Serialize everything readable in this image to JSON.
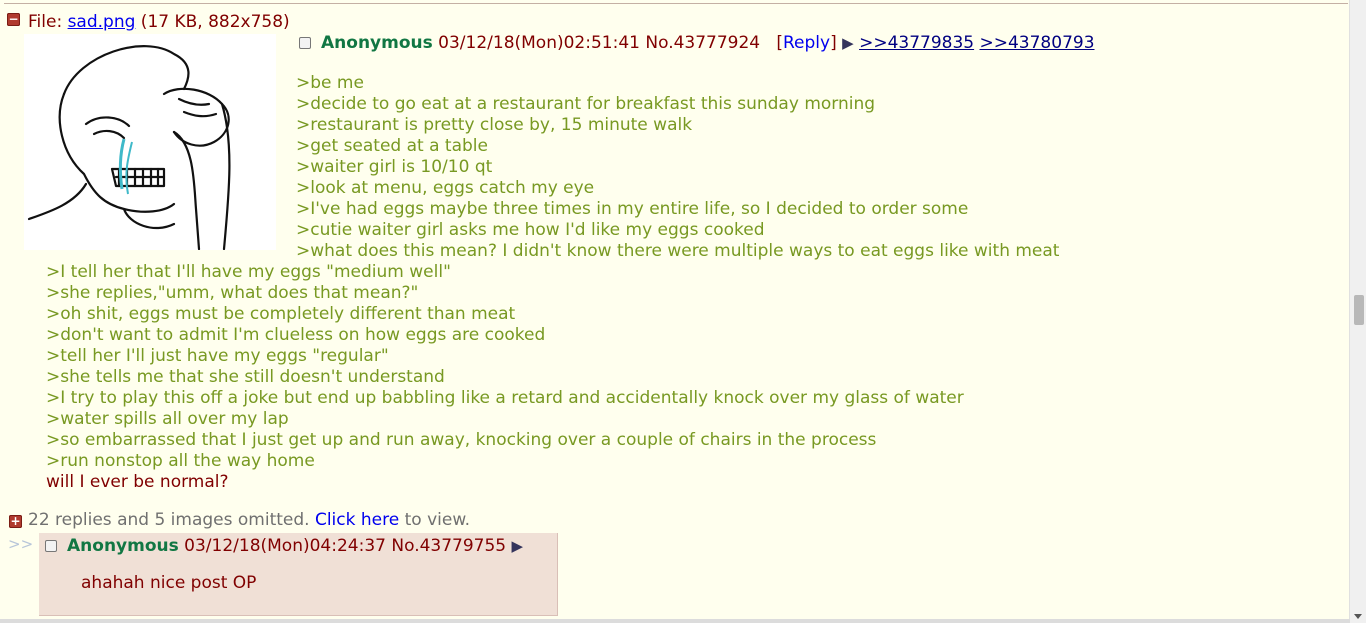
{
  "op": {
    "toggle_symbol": "−",
    "file_prefix": "File: ",
    "file_name": "sad.png",
    "file_meta": " (17 KB, 882x758)",
    "name": "Anonymous",
    "datetime": "03/12/18(Mon)02:51:41",
    "post_no": "No.43777924",
    "reply_label": "Reply",
    "backlinks": [
      ">>43779835",
      ">>43780793"
    ],
    "lines_beside_image": [
      ">be me",
      ">decide to go eat at a restaurant for breakfast this sunday morning",
      ">restaurant is pretty close by, 15 minute walk",
      ">get seated at a table",
      ">waiter girl is 10/10 qt",
      ">look at menu, eggs catch my eye",
      ">I've had eggs maybe three times in my entire life, so I decided to order some",
      ">cutie waiter girl asks me how I'd like my eggs cooked",
      ">what does this mean? I didn't know there were multiple ways to eat eggs like with meat"
    ],
    "lines_below_image": [
      ">I tell her that I'll have my eggs \"medium well\"",
      ">she replies,\"umm, what does that mean?\"",
      ">oh shit, eggs must be completely different than meat",
      ">don't want to admit I'm clueless on how eggs are cooked",
      ">tell her I'll just have my eggs \"regular\"",
      ">she tells me that she still doesn't understand",
      ">I try to play this off a joke but end up babbling like a retard and accidentally knock over my glass of water",
      ">water spills all over my lap",
      ">so embarrassed that I just get up and run away, knocking over a couple of chairs in the process",
      ">run nonstop all the way home"
    ],
    "last_line": "will I ever be normal?"
  },
  "omitted": {
    "toggle_symbol": "+",
    "text": "22 replies and 5 images omitted. ",
    "link": "Click here",
    "suffix": " to view."
  },
  "reply": {
    "side_arrows": ">>",
    "name": "Anonymous",
    "datetime": "03/12/18(Mon)04:24:37",
    "post_no": "No.43779755",
    "text": "ahahah nice post OP"
  },
  "colors": {
    "background": "#ffffee",
    "text": "#800000",
    "name": "#117743",
    "greentext": "#789922",
    "reply_bg": "#f0e0d6",
    "link": "#0000ee"
  }
}
